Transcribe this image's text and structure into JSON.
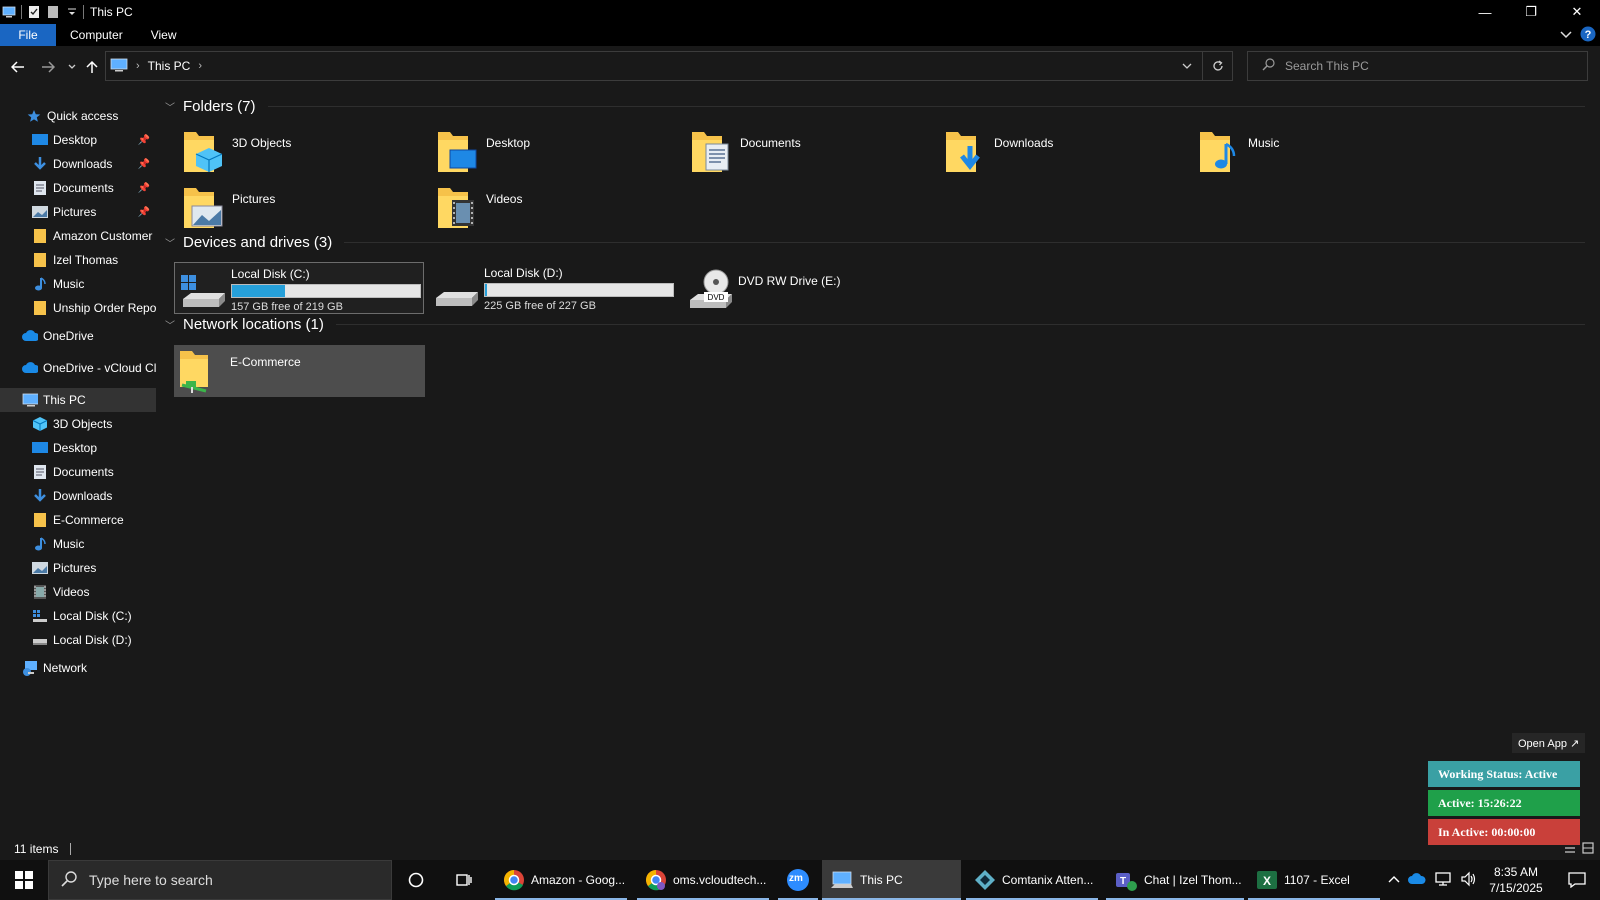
{
  "window": {
    "title": "This PC",
    "minimize": "—",
    "restore": "❐",
    "close": "✕"
  },
  "ribbon": {
    "tabs": [
      "File",
      "Computer",
      "View"
    ]
  },
  "address": {
    "location": "This PC",
    "search_placeholder": "Search This PC"
  },
  "nav": {
    "quick_access": "Quick access",
    "quick_items": [
      "Desktop",
      "Downloads",
      "Documents",
      "Pictures",
      "Amazon Customer",
      "Izel Thomas",
      "Music",
      "Unship Order Report"
    ],
    "onedrive": "OneDrive",
    "onedrive_vcloud": "OneDrive - vCloud Cl",
    "this_pc": "This PC",
    "pc_items": [
      "3D Objects",
      "Desktop",
      "Documents",
      "Downloads",
      "E-Commerce",
      "Music",
      "Pictures",
      "Videos",
      "Local Disk (C:)",
      "Local Disk (D:)"
    ],
    "network": "Network"
  },
  "content": {
    "folders_header": "Folders (7)",
    "folders": [
      "3D Objects",
      "Desktop",
      "Documents",
      "Downloads",
      "Music",
      "Pictures",
      "Videos"
    ],
    "drives_header": "Devices and drives (3)",
    "drive_c": {
      "name": "Local Disk (C:)",
      "free": "157 GB free of 219 GB",
      "used_fraction": 0.28
    },
    "drive_d": {
      "name": "Local Disk (D:)",
      "free": "225 GB free of 227 GB",
      "used_fraction": 0.01
    },
    "dvd": {
      "name": "DVD RW Drive (E:)",
      "badge": "DVD"
    },
    "network_header": "Network locations (1)",
    "network_locations": [
      "E-Commerce"
    ]
  },
  "status": {
    "items_count": "11 items"
  },
  "widget": {
    "open_app": "Open App ↗",
    "working_status": "Working Status: Active",
    "active": "Active: 15:26:22",
    "inactive": "In Active: 00:00:00",
    "colors": {
      "status": "#3aa0a4",
      "active": "#1fa04a",
      "inactive": "#c9403a"
    }
  },
  "taskbar": {
    "search_placeholder": "Type here to search",
    "apps": [
      {
        "label": "Amazon - Goog..."
      },
      {
        "label": "oms.vcloudtech..."
      },
      {
        "label": "zm"
      },
      {
        "label": "This PC"
      },
      {
        "label": "Comtanix Atten..."
      },
      {
        "label": "Chat | Izel Thom..."
      },
      {
        "label": "1107 - Excel"
      }
    ],
    "time": "8:35 AM",
    "date": "7/15/2025"
  },
  "colors": {
    "accent": "#1a66c2",
    "folder": "#f6c24a",
    "drive_fill": "#26a0da"
  }
}
